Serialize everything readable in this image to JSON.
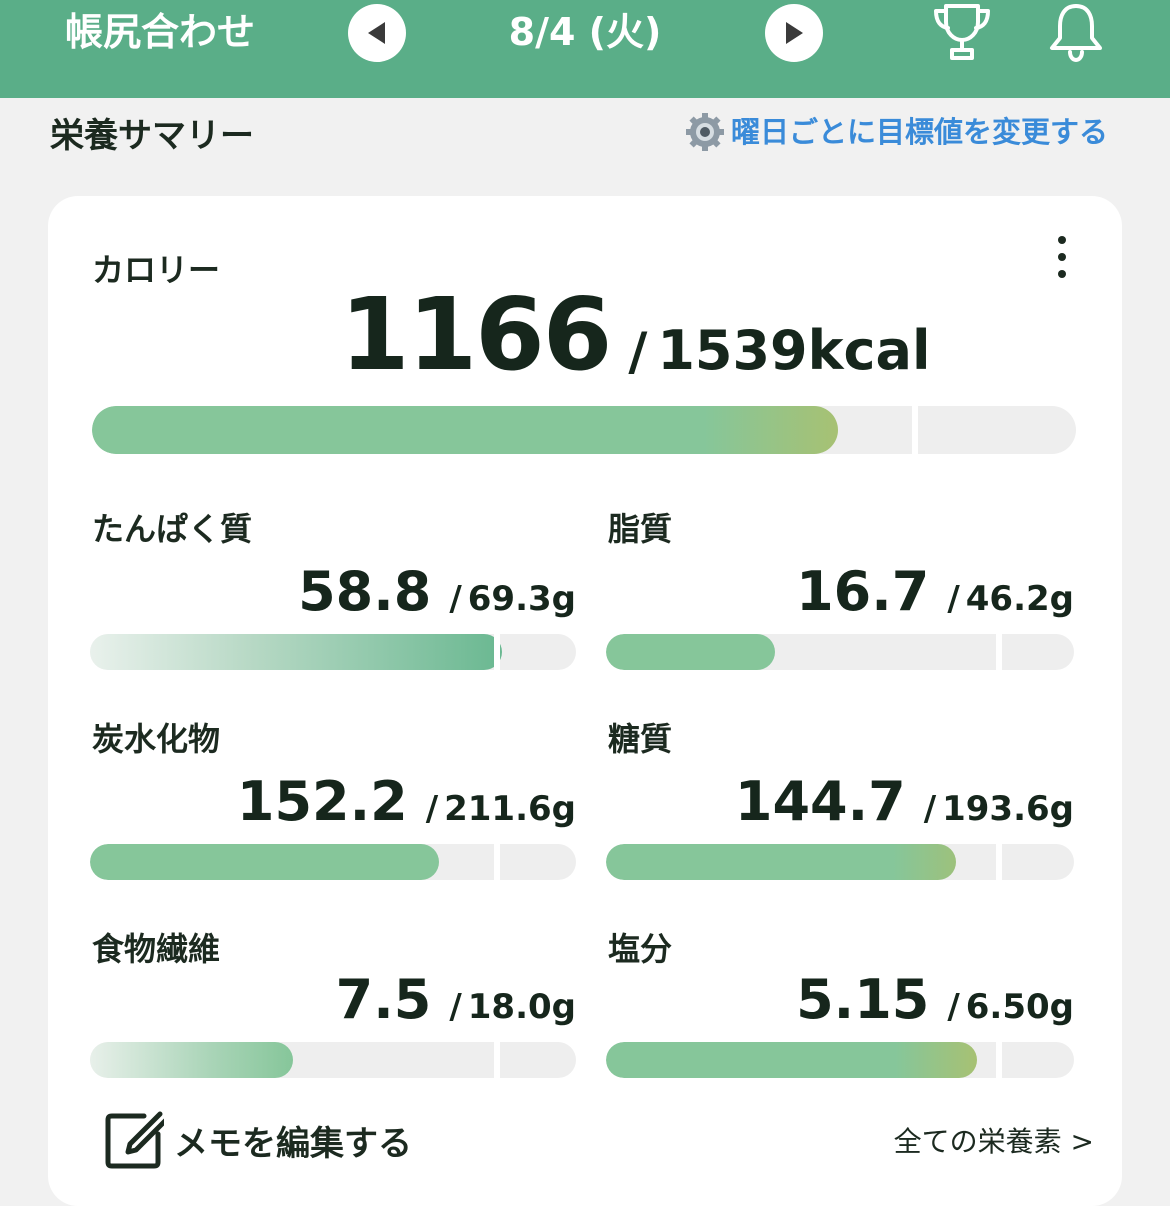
{
  "header": {
    "title": "帳尻合わせ",
    "date": "8/4 (火)",
    "prev_icon": "triangle-left-icon",
    "next_icon": "triangle-right-icon",
    "trophy_icon": "trophy-icon",
    "bell_icon": "bell-icon"
  },
  "section": {
    "title": "栄養サマリー",
    "change_link": "曜日ごとに目標値を変更する",
    "change_icon": "gear-icon"
  },
  "calorie": {
    "label": "カロリー",
    "value": "1166",
    "separator": "/",
    "target": "1539kcal",
    "progress": 0.758
  },
  "nutrients": [
    {
      "key": "protein",
      "label": "たんぱく質",
      "value": "58.8",
      "separator": "/",
      "target": "69.3g",
      "progress": 0.848,
      "fill": "linear-gradient(90deg,#e9f1ec 0%,#b6d8c4 40%,#6ab891 100%)"
    },
    {
      "key": "fat",
      "label": "脂質",
      "value": "16.7",
      "separator": "/",
      "target": "46.2g",
      "progress": 0.361,
      "fill": "#86c69a"
    },
    {
      "key": "carbs",
      "label": "炭水化物",
      "value": "152.2",
      "separator": "/",
      "target": "211.6g",
      "progress": 0.719,
      "fill": "#86c69a"
    },
    {
      "key": "sugar",
      "label": "糖質",
      "value": "144.7",
      "separator": "/",
      "target": "193.6g",
      "progress": 0.747,
      "fill": "linear-gradient(90deg,#86c69a 0%,#86c69a 82%,#9dc17c 100%)"
    },
    {
      "key": "fiber",
      "label": "食物繊維",
      "value": "7.5",
      "separator": "/",
      "target": "18.0g",
      "progress": 0.417,
      "fill": "linear-gradient(90deg,#e8f0ea 0%,#a9d4b7 60%,#86c69a 100%)"
    },
    {
      "key": "salt",
      "label": "塩分",
      "value": "5.15",
      "separator": "/",
      "target": "6.50g",
      "progress": 0.792,
      "fill": "linear-gradient(90deg,#86c69a 0%,#86c69a 78%,#a7c173 100%)"
    }
  ],
  "footer": {
    "memo_label": "メモを編集する",
    "memo_icon": "edit-memo-icon",
    "all_link": "全ての栄養素 >"
  },
  "colors": {
    "header_bg": "#5aae88",
    "link": "#3a8bd9",
    "bar_fill": "#86c69a",
    "bar_track": "#eeeeee"
  }
}
